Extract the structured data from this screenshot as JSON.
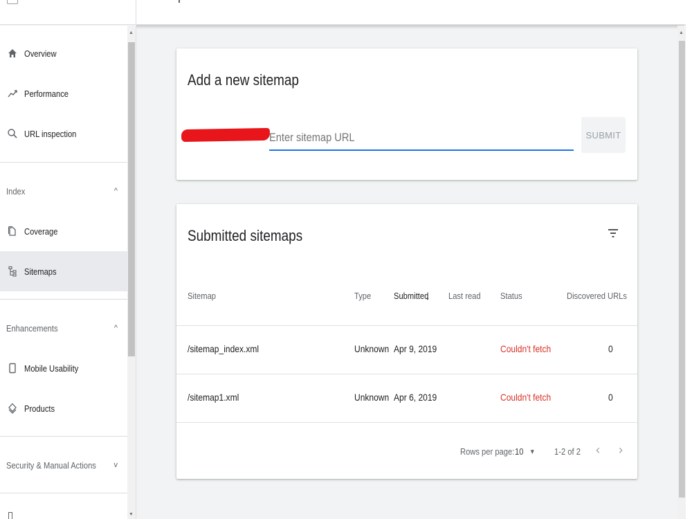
{
  "sidebar": {
    "items_top": [
      {
        "label": "Overview",
        "icon": "home-icon"
      },
      {
        "label": "Performance",
        "icon": "trending-up-icon"
      },
      {
        "label": "URL inspection",
        "icon": "search-icon"
      }
    ],
    "sections": [
      {
        "label": "Index",
        "chevron": "^",
        "expanded": true
      },
      {
        "label": "Enhancements",
        "chevron": "^",
        "expanded": true
      },
      {
        "label": "Security & Manual Actions",
        "chevron": "v",
        "expanded": false
      }
    ],
    "index_items": [
      {
        "label": "Coverage",
        "icon": "file-icon"
      },
      {
        "label": "Sitemaps",
        "icon": "sitemap-icon",
        "active": true
      }
    ],
    "enhancement_items": [
      {
        "label": "Mobile Usability",
        "icon": "phone-icon"
      },
      {
        "label": "Products",
        "icon": "diamond-icon"
      }
    ]
  },
  "add_sitemap": {
    "title": "Add a new sitemap",
    "placeholder": "Enter sitemap URL",
    "submit_label": "SUBMIT"
  },
  "submitted": {
    "title": "Submitted sitemaps",
    "columns": [
      "Sitemap",
      "Type",
      "Submitted",
      "Last read",
      "Status",
      "Discovered URLs"
    ],
    "sort_arrow": "↓",
    "rows": [
      {
        "sitemap": "/sitemap_index.xml",
        "type": "Unknown",
        "submitted": "Apr 9, 2019",
        "last_read": "",
        "status": "Couldn't fetch",
        "discovered": "0"
      },
      {
        "sitemap": "/sitemap1.xml",
        "type": "Unknown",
        "submitted": "Apr 6, 2019",
        "last_read": "",
        "status": "Couldn't fetch",
        "discovered": "0"
      }
    ],
    "pagination": {
      "rows_per_page_label": "Rows per page:",
      "rows_per_page": "10",
      "range": "1-2 of 2",
      "prev": "‹",
      "next": "›"
    }
  },
  "colors": {
    "accent": "#1a73e8",
    "error": "#d93025",
    "active_bg": "#e8eaed"
  }
}
